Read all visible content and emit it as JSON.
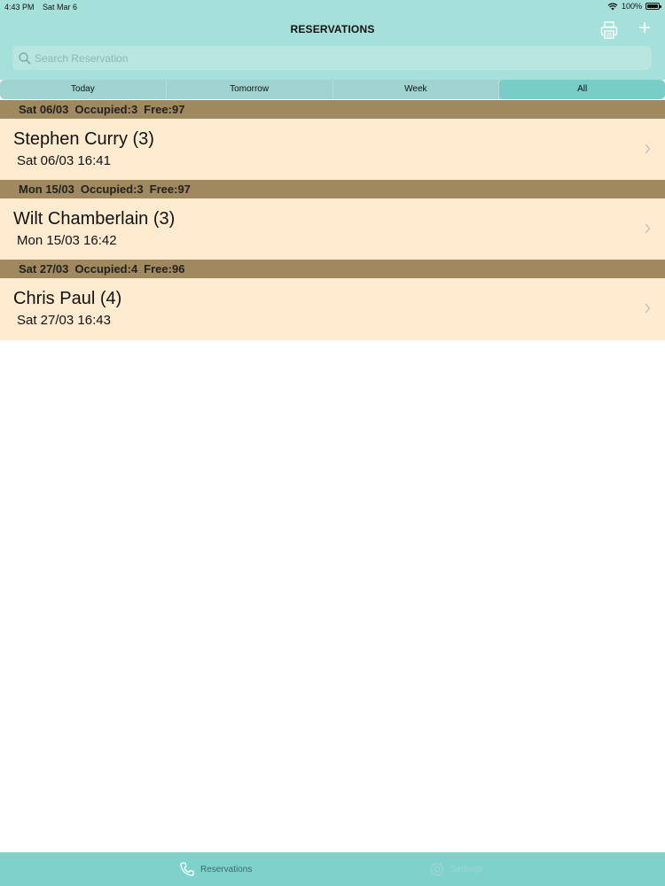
{
  "status_bar": {
    "time": "4:43 PM",
    "date": "Sat Mar 6",
    "battery": "100%",
    "battery_level": 1.0
  },
  "nav": {
    "title": "RESERVATIONS",
    "print_icon": "printer-icon",
    "add_icon": "plus-icon",
    "add_glyph": "+"
  },
  "search": {
    "placeholder": "Search Reservation",
    "value": ""
  },
  "segments": {
    "today": "Today",
    "tomorrow": "Tomorrow",
    "week": "Week",
    "all": "All",
    "selected": "All"
  },
  "sections": [
    {
      "date": "Sat 06/03",
      "occupied": "Occupied:3",
      "free": "Free:97",
      "rows": [
        {
          "name": "Stephen Curry  (3)",
          "datetime": "Sat 06/03 16:41"
        }
      ]
    },
    {
      "date": "Mon 15/03",
      "occupied": "Occupied:3",
      "free": "Free:97",
      "rows": [
        {
          "name": "Wilt Chamberlain  (3)",
          "datetime": "Mon 15/03 16:42"
        }
      ]
    },
    {
      "date": "Sat 27/03",
      "occupied": "Occupied:4",
      "free": "Free:96",
      "rows": [
        {
          "name": "Chris Paul  (4)",
          "datetime": "Sat 27/03 16:43"
        }
      ]
    }
  ],
  "tab_bar": {
    "reservations": "Reservations",
    "settings": "Settings"
  },
  "colors": {
    "accent": "#a6e0db",
    "section": "#a0895e",
    "row": "#ffecd0",
    "tab_bar": "#7fd2cb"
  }
}
